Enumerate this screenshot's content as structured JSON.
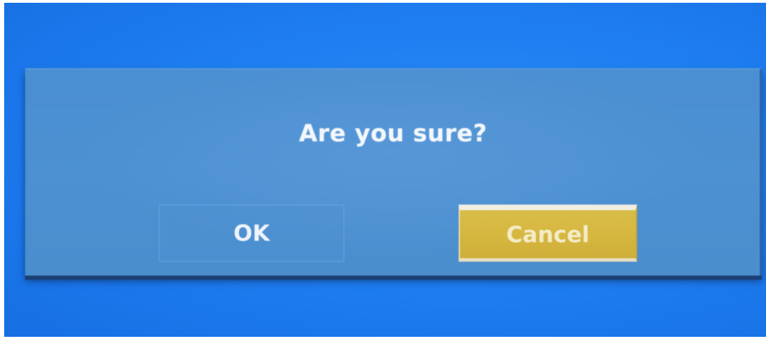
{
  "dialog": {
    "message": "Are you sure?",
    "ok_label": "OK",
    "cancel_label": "Cancel",
    "focused_button": "Cancel"
  },
  "colors": {
    "screen_background": "#1f7ff2",
    "dialog_background": "#4b8fd1",
    "focus_highlight": "#d6b740",
    "text": "#f3f7fc"
  }
}
